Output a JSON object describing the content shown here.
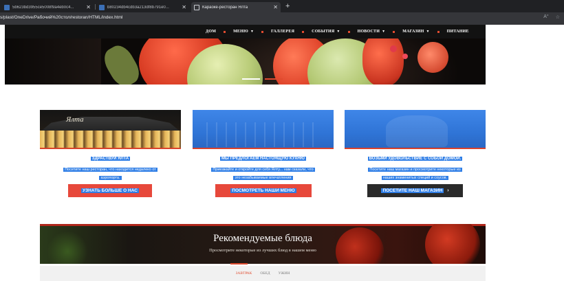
{
  "browser": {
    "tabs": [
      {
        "title": "5b623bd3955ce5008f9a4eb0c4..."
      },
      {
        "title": "b80234db4cdb3a213df8b791e0..."
      },
      {
        "title": "Караоке-ресторан Ялта"
      }
    ],
    "url": "s/plast/OneDrive/Рабочий%20стол/restoran/HTML/index.html"
  },
  "nav": {
    "items": [
      {
        "label": "ДОМ",
        "dropdown": false
      },
      {
        "label": "МЕНЮ",
        "dropdown": true
      },
      {
        "label": "ГАЛЛЕРЕЯ",
        "dropdown": false
      },
      {
        "label": "СОБЫТИЯ",
        "dropdown": true
      },
      {
        "label": "НОВОСТИ",
        "dropdown": true
      },
      {
        "label": "МАГАЗИН",
        "dropdown": true
      },
      {
        "label": "ПИТАНИЕ",
        "dropdown": false
      }
    ]
  },
  "cards": [
    {
      "sign": "Ялта",
      "title": "ЗДРАСТВУЙ ЯЛТА",
      "desc1": "Посетите наш ресторан, что находится недалеко от",
      "desc2": "аэропорта.",
      "button": "УЗНАТЬ БОЛЬШЕ О НАС"
    },
    {
      "title": "МЫ ПРЕДЛОГАЕМ НАСТОЯЩУЮ КУХНЮ",
      "desc1": "Приезжайте и откройте для себя Ялту... нам сказали, что",
      "desc2": "это незабываемые впечатления",
      "button": "ПОСМОТРЕТЬ НАШИ МЕНЮ"
    },
    {
      "title": "ВОЗЬМИ УДОВОЛЬСТВИЕ С СОБОЙ ДОМОЙ.",
      "desc1": "Посетите наш магазин и просмотрите некоторые из",
      "desc2": "наших знаменитых специй и соусов.",
      "button": "ПОСЕТИТЕ НАШ МАГАЗИН",
      "button_arrow": "›"
    }
  ],
  "featured": {
    "title": "Рекомендуемые блюда",
    "subtitle": "Просмотрите некоторые из лучших блюд в нашем меню",
    "tabs": [
      "ЗАВТРАК",
      "ОБЕД",
      "УЖИН"
    ],
    "active_tab": 0
  },
  "colors": {
    "accent": "#e04b2f",
    "button_red": "#e7483b",
    "button_dark": "#2a2a2a",
    "selection_blue": "#2f7ee6"
  },
  "icons": [
    "image-favicon-icon",
    "page-favicon-icon",
    "close-icon",
    "plus-icon",
    "read-aloud-icon",
    "favorites-icon",
    "chevron-down-icon",
    "arrow-right-icon"
  ]
}
